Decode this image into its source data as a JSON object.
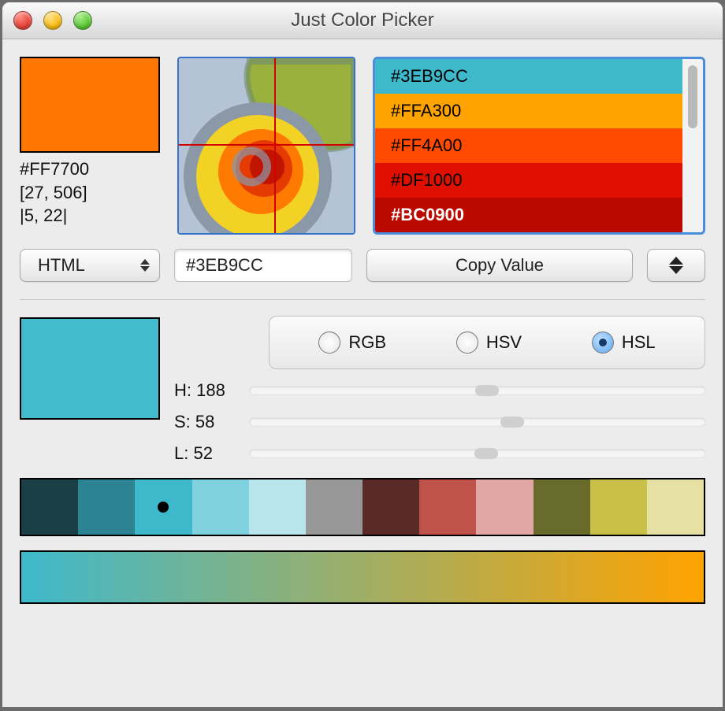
{
  "window": {
    "title": "Just Color Picker"
  },
  "current": {
    "swatch_color": "#FF7700",
    "hex": "#FF7700",
    "pos": "[27, 506]",
    "delta": "|5, 22|"
  },
  "history": [
    {
      "hex": "#3EB9CC",
      "bg": "#3EB9CC",
      "fg": "#000000",
      "selected": false
    },
    {
      "hex": "#FFA300",
      "bg": "#FFA300",
      "fg": "#000000",
      "selected": false
    },
    {
      "hex": "#FF4A00",
      "bg": "#FF4A00",
      "fg": "#000000",
      "selected": false
    },
    {
      "hex": "#DF1000",
      "bg": "#DF1000",
      "fg": "#000000",
      "selected": false
    },
    {
      "hex": "#BC0900",
      "bg": "#BC0900",
      "fg": "#FFFFFF",
      "selected": true
    }
  ],
  "history_last_hint": {
    "bg": "#000000"
  },
  "controls": {
    "format_label": "HTML",
    "value_field": "#3EB9CC",
    "copy_label": "Copy Value"
  },
  "modes": {
    "rgb_label": "RGB",
    "hsv_label": "HSV",
    "hsl_label": "HSL",
    "selected": "HSL"
  },
  "hsl": {
    "swatch_color": "#44BBCC",
    "h_label": "H: 188",
    "s_label": "S: 58",
    "l_label": "L: 52",
    "h_value": 188,
    "h_max": 360,
    "s_value": 58,
    "s_max": 100,
    "l_value": 52,
    "l_max": 100
  },
  "palette": [
    "#1A3F44",
    "#2C8391",
    "#3EB9CC",
    "#7ED1DD",
    "#B8E5EC",
    "#989898",
    "#592A28",
    "#BF524A",
    "#E2A6A4",
    "#686B2C",
    "#C9C04A",
    "#E7E0A4"
  ],
  "palette_marked_index": 2,
  "gradient": {
    "from": "#3EB9CC",
    "to": "#FFA300"
  }
}
